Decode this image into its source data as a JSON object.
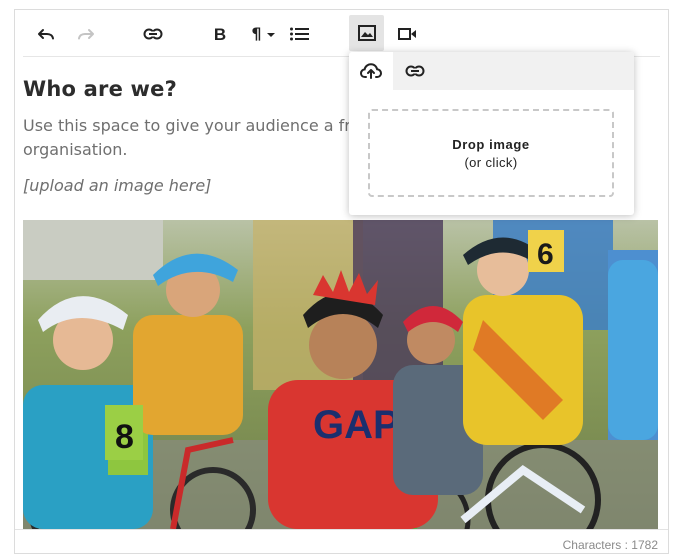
{
  "toolbar": {
    "buttons": [
      {
        "name": "undo-button",
        "icon": "undo-icon"
      },
      {
        "name": "redo-button",
        "icon": "redo-icon",
        "state": "disabled"
      },
      {
        "name": "link-button",
        "icon": "link-icon"
      },
      {
        "name": "bold-button",
        "glyph": "B"
      },
      {
        "name": "paragraph-format-button",
        "glyph": "¶"
      },
      {
        "name": "bulleted-list-button",
        "icon": "bulleted-list-icon"
      },
      {
        "name": "image-button",
        "icon": "image-icon",
        "state": "active"
      },
      {
        "name": "video-button",
        "icon": "video-icon"
      }
    ]
  },
  "content": {
    "heading": "Who are we?",
    "intro": "Use this space to give your audience a frien",
    "intro_line2": "organisation.",
    "placeholder": "[upload an image here]"
  },
  "image_popover": {
    "tabs": [
      {
        "name": "upload",
        "icon": "cloud-upload-icon",
        "active": true
      },
      {
        "name": "from-url",
        "icon": "link-icon",
        "active": false
      }
    ],
    "dropzone_title": "Drop image",
    "dropzone_subtitle": "(or click)"
  },
  "photo": {
    "jersey_text": "GAP",
    "bib_numbers": [
      "8",
      "6"
    ]
  },
  "footer": {
    "char_count": "Characters : 1782"
  },
  "colors": {
    "border": "#dcdcdc",
    "active_button_bg": "#e4e4e4",
    "text_muted": "#6f6f6f",
    "heading": "#2c2c2c"
  }
}
